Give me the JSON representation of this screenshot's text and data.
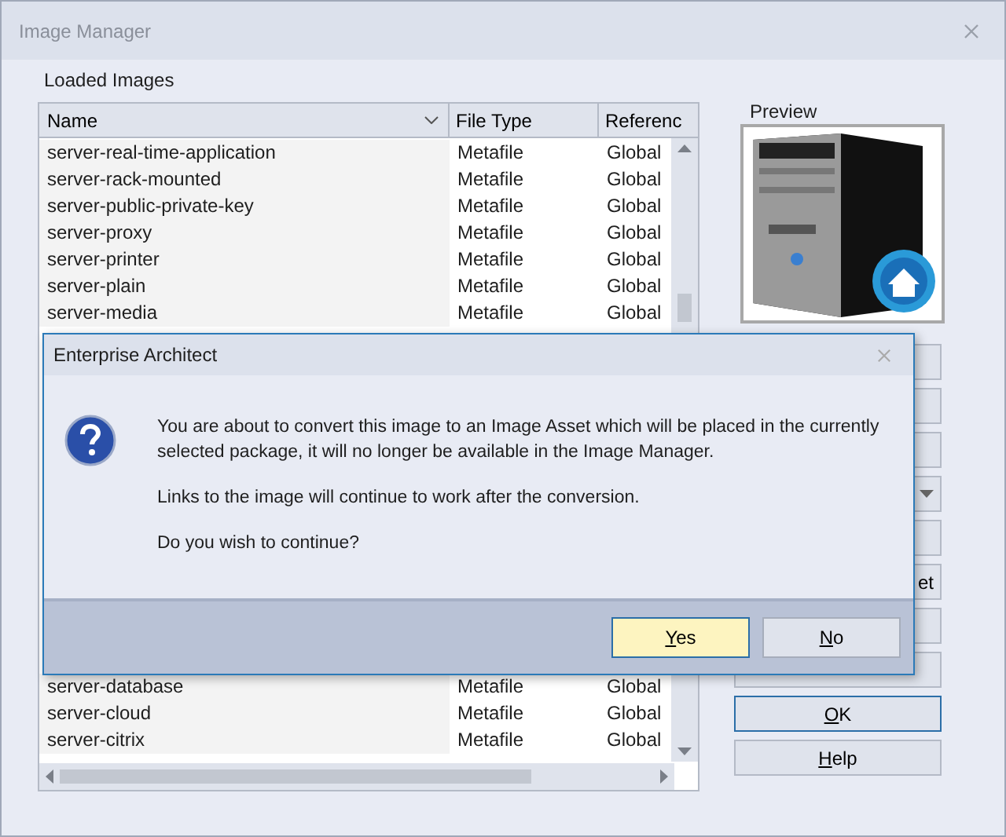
{
  "window": {
    "title": "Image Manager"
  },
  "loaded_images": {
    "label": "Loaded Images",
    "columns": [
      "Name",
      "File Type",
      "Referenc"
    ],
    "rows_above": [
      {
        "name": "server-real-time-application",
        "file_type": "Metafile",
        "reference": "Global"
      },
      {
        "name": "server-rack-mounted",
        "file_type": "Metafile",
        "reference": "Global"
      },
      {
        "name": "server-public-private-key",
        "file_type": "Metafile",
        "reference": "Global"
      },
      {
        "name": "server-proxy",
        "file_type": "Metafile",
        "reference": "Global"
      },
      {
        "name": "server-printer",
        "file_type": "Metafile",
        "reference": "Global"
      },
      {
        "name": "server-plain",
        "file_type": "Metafile",
        "reference": "Global"
      },
      {
        "name": "server-media",
        "file_type": "Metafile",
        "reference": "Global"
      }
    ],
    "rows_below": [
      {
        "name": "server-database",
        "file_type": "Metafile",
        "reference": "Global"
      },
      {
        "name": "server-cloud",
        "file_type": "Metafile",
        "reference": "Global"
      },
      {
        "name": "server-citrix",
        "file_type": "Metafile",
        "reference": "Global"
      }
    ]
  },
  "preview": {
    "label": "Preview"
  },
  "side_buttons": [
    {
      "kind": "button"
    },
    {
      "kind": "button"
    },
    {
      "kind": "button"
    },
    {
      "kind": "dropdown"
    },
    {
      "kind": "button"
    },
    {
      "kind": "button",
      "label": "et"
    },
    {
      "kind": "button"
    },
    {
      "kind": "button"
    }
  ],
  "ok_button": "OK",
  "help_button": "Help",
  "dialog": {
    "title": "Enterprise Architect",
    "paragraphs": [
      "You are about to convert this image to an Image Asset which will be placed in the currently selected package, it will no longer be available in the Image Manager.",
      "Links to the image will continue to work after the conversion.",
      "Do you wish to continue?"
    ],
    "buttons": [
      {
        "label": "Yes",
        "selected": true
      },
      {
        "label": "No",
        "selected": false
      }
    ]
  }
}
